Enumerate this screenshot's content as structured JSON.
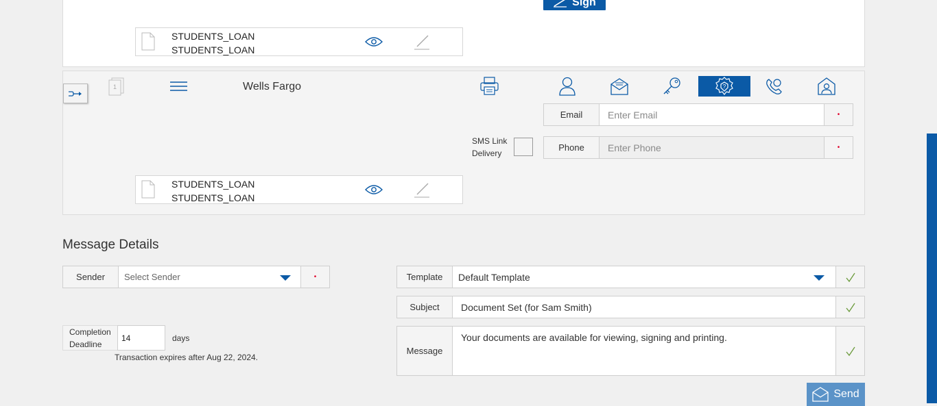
{
  "top_card": {
    "sign_label": "Sign",
    "document": {
      "name_line1": "STUDENTS_LOAN",
      "name_line2": "STUDENTS_LOAN"
    }
  },
  "recipient": {
    "sequence_number": "1",
    "name": "Wells Fargo",
    "auth_methods": [
      "person-icon",
      "email-envelope-icon",
      "key-icon",
      "security-question-shield-icon",
      "phone-auth-icon",
      "id-check-icon"
    ],
    "active_auth": "security-question-shield-icon",
    "email": {
      "label": "Email",
      "placeholder": "Enter Email",
      "required_mark": "•"
    },
    "phone": {
      "label": "Phone",
      "placeholder": "Enter Phone",
      "required_mark": "•"
    },
    "sms_link_delivery": {
      "line1": "SMS Link",
      "line2": "Delivery",
      "checked": false
    },
    "document": {
      "name_line1": "STUDENTS_LOAN",
      "name_line2": "STUDENTS_LOAN"
    }
  },
  "message_details": {
    "title": "Message Details",
    "sender": {
      "label": "Sender",
      "value": "Select Sender",
      "required_mark": "•"
    },
    "completion_deadline": {
      "label_line1": "Completion",
      "label_line2": "Deadline",
      "value": "14",
      "unit": "days"
    },
    "expires_text": "Transaction expires after Aug 22, 2024.",
    "template": {
      "label": "Template",
      "value": "Default Template"
    },
    "subject": {
      "label": "Subject",
      "value": "Document Set (for Sam Smith)"
    },
    "message": {
      "label": "Message",
      "value": "Your documents are available for viewing, signing and printing."
    },
    "send_label": "Send"
  },
  "colors": {
    "accent": "#0b5aa6",
    "send_button": "#5b93c8",
    "check": "#6a9a3a",
    "required": "#e0002a"
  }
}
